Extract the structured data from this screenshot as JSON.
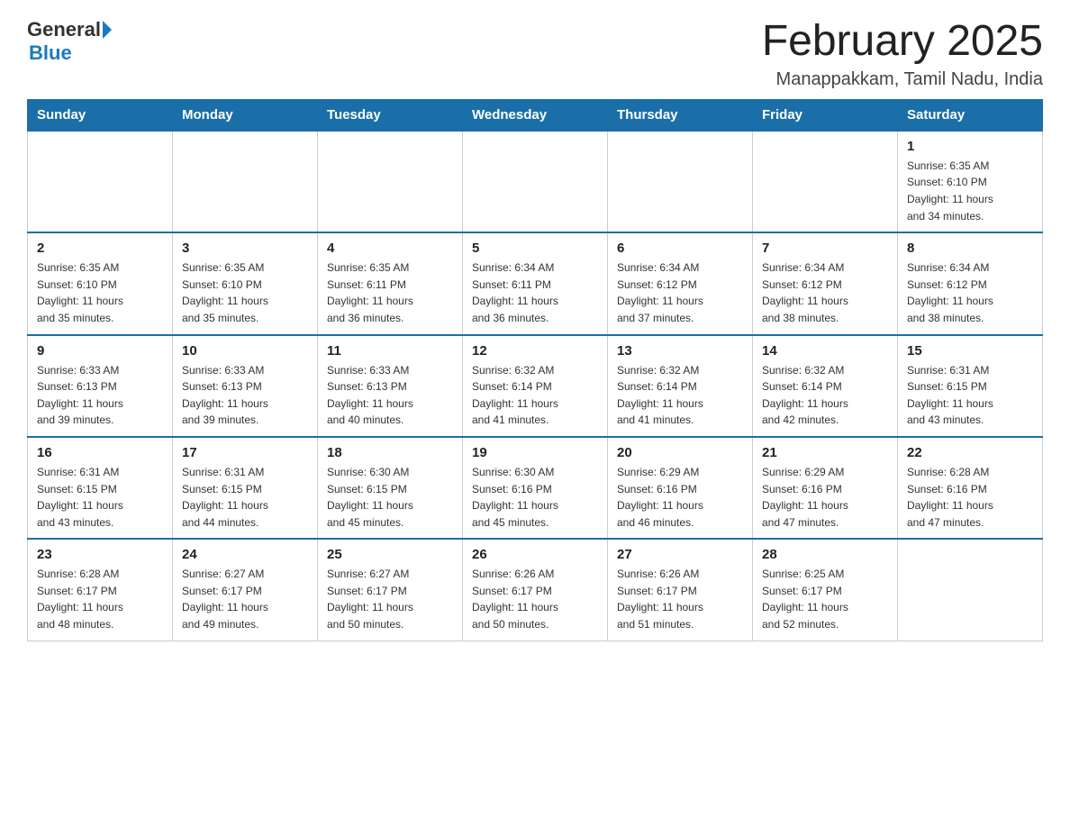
{
  "logo": {
    "general": "General",
    "blue": "Blue"
  },
  "title": "February 2025",
  "location": "Manappakkam, Tamil Nadu, India",
  "days_of_week": [
    "Sunday",
    "Monday",
    "Tuesday",
    "Wednesday",
    "Thursday",
    "Friday",
    "Saturday"
  ],
  "weeks": [
    [
      {
        "date": "",
        "info": ""
      },
      {
        "date": "",
        "info": ""
      },
      {
        "date": "",
        "info": ""
      },
      {
        "date": "",
        "info": ""
      },
      {
        "date": "",
        "info": ""
      },
      {
        "date": "",
        "info": ""
      },
      {
        "date": "1",
        "info": "Sunrise: 6:35 AM\nSunset: 6:10 PM\nDaylight: 11 hours\nand 34 minutes."
      }
    ],
    [
      {
        "date": "2",
        "info": "Sunrise: 6:35 AM\nSunset: 6:10 PM\nDaylight: 11 hours\nand 35 minutes."
      },
      {
        "date": "3",
        "info": "Sunrise: 6:35 AM\nSunset: 6:10 PM\nDaylight: 11 hours\nand 35 minutes."
      },
      {
        "date": "4",
        "info": "Sunrise: 6:35 AM\nSunset: 6:11 PM\nDaylight: 11 hours\nand 36 minutes."
      },
      {
        "date": "5",
        "info": "Sunrise: 6:34 AM\nSunset: 6:11 PM\nDaylight: 11 hours\nand 36 minutes."
      },
      {
        "date": "6",
        "info": "Sunrise: 6:34 AM\nSunset: 6:12 PM\nDaylight: 11 hours\nand 37 minutes."
      },
      {
        "date": "7",
        "info": "Sunrise: 6:34 AM\nSunset: 6:12 PM\nDaylight: 11 hours\nand 38 minutes."
      },
      {
        "date": "8",
        "info": "Sunrise: 6:34 AM\nSunset: 6:12 PM\nDaylight: 11 hours\nand 38 minutes."
      }
    ],
    [
      {
        "date": "9",
        "info": "Sunrise: 6:33 AM\nSunset: 6:13 PM\nDaylight: 11 hours\nand 39 minutes."
      },
      {
        "date": "10",
        "info": "Sunrise: 6:33 AM\nSunset: 6:13 PM\nDaylight: 11 hours\nand 39 minutes."
      },
      {
        "date": "11",
        "info": "Sunrise: 6:33 AM\nSunset: 6:13 PM\nDaylight: 11 hours\nand 40 minutes."
      },
      {
        "date": "12",
        "info": "Sunrise: 6:32 AM\nSunset: 6:14 PM\nDaylight: 11 hours\nand 41 minutes."
      },
      {
        "date": "13",
        "info": "Sunrise: 6:32 AM\nSunset: 6:14 PM\nDaylight: 11 hours\nand 41 minutes."
      },
      {
        "date": "14",
        "info": "Sunrise: 6:32 AM\nSunset: 6:14 PM\nDaylight: 11 hours\nand 42 minutes."
      },
      {
        "date": "15",
        "info": "Sunrise: 6:31 AM\nSunset: 6:15 PM\nDaylight: 11 hours\nand 43 minutes."
      }
    ],
    [
      {
        "date": "16",
        "info": "Sunrise: 6:31 AM\nSunset: 6:15 PM\nDaylight: 11 hours\nand 43 minutes."
      },
      {
        "date": "17",
        "info": "Sunrise: 6:31 AM\nSunset: 6:15 PM\nDaylight: 11 hours\nand 44 minutes."
      },
      {
        "date": "18",
        "info": "Sunrise: 6:30 AM\nSunset: 6:15 PM\nDaylight: 11 hours\nand 45 minutes."
      },
      {
        "date": "19",
        "info": "Sunrise: 6:30 AM\nSunset: 6:16 PM\nDaylight: 11 hours\nand 45 minutes."
      },
      {
        "date": "20",
        "info": "Sunrise: 6:29 AM\nSunset: 6:16 PM\nDaylight: 11 hours\nand 46 minutes."
      },
      {
        "date": "21",
        "info": "Sunrise: 6:29 AM\nSunset: 6:16 PM\nDaylight: 11 hours\nand 47 minutes."
      },
      {
        "date": "22",
        "info": "Sunrise: 6:28 AM\nSunset: 6:16 PM\nDaylight: 11 hours\nand 47 minutes."
      }
    ],
    [
      {
        "date": "23",
        "info": "Sunrise: 6:28 AM\nSunset: 6:17 PM\nDaylight: 11 hours\nand 48 minutes."
      },
      {
        "date": "24",
        "info": "Sunrise: 6:27 AM\nSunset: 6:17 PM\nDaylight: 11 hours\nand 49 minutes."
      },
      {
        "date": "25",
        "info": "Sunrise: 6:27 AM\nSunset: 6:17 PM\nDaylight: 11 hours\nand 50 minutes."
      },
      {
        "date": "26",
        "info": "Sunrise: 6:26 AM\nSunset: 6:17 PM\nDaylight: 11 hours\nand 50 minutes."
      },
      {
        "date": "27",
        "info": "Sunrise: 6:26 AM\nSunset: 6:17 PM\nDaylight: 11 hours\nand 51 minutes."
      },
      {
        "date": "28",
        "info": "Sunrise: 6:25 AM\nSunset: 6:17 PM\nDaylight: 11 hours\nand 52 minutes."
      },
      {
        "date": "",
        "info": ""
      }
    ]
  ]
}
